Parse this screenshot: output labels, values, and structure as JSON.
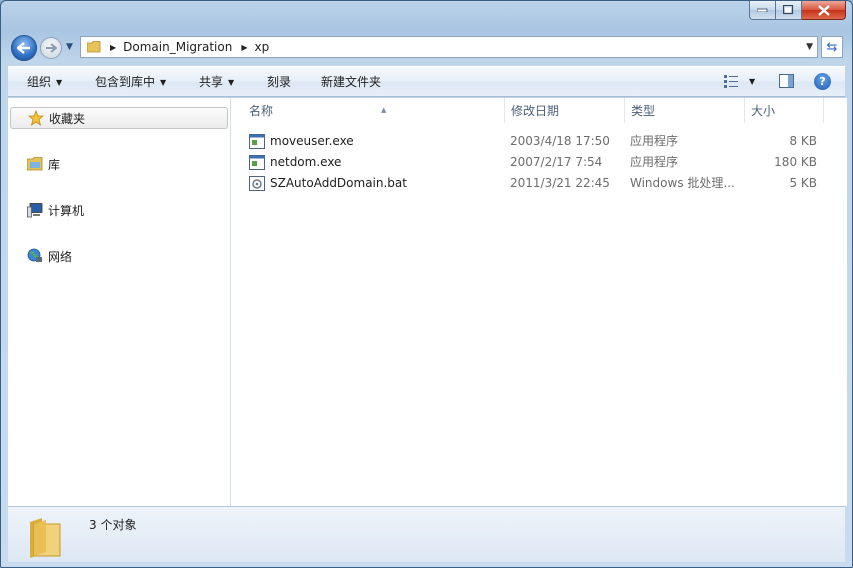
{
  "window": {
    "caption_buttons": {
      "minimize": "minimize",
      "maximize": "maximize",
      "close": "close"
    }
  },
  "address": {
    "breadcrumbs": [
      "Domain_Migration",
      "xp"
    ]
  },
  "toolbar": {
    "organize": "组织",
    "include_in_library": "包含到库中",
    "share": "共享",
    "burn": "刻录",
    "new_folder": "新建文件夹"
  },
  "nav": {
    "items": [
      {
        "label": "收藏夹",
        "icon": "star-icon"
      },
      {
        "label": "库",
        "icon": "library-icon"
      },
      {
        "label": "计算机",
        "icon": "computer-icon"
      },
      {
        "label": "网络",
        "icon": "network-icon"
      }
    ]
  },
  "columns": {
    "name": "名称",
    "date": "修改日期",
    "type": "类型",
    "size": "大小"
  },
  "files": [
    {
      "name": "moveuser.exe",
      "date": "2003/4/18 17:50",
      "type": "应用程序",
      "size": "8 KB",
      "icon": "exe-icon"
    },
    {
      "name": "netdom.exe",
      "date": "2007/2/17 7:54",
      "type": "应用程序",
      "size": "180 KB",
      "icon": "exe-icon"
    },
    {
      "name": "SZAutoAddDomain.bat",
      "date": "2011/3/21 22:45",
      "type": "Windows 批处理...",
      "size": "5 KB",
      "icon": "bat-icon"
    }
  ],
  "status": {
    "count_text": "3 个对象"
  },
  "colors": {
    "accent": "#2e6fc3",
    "close": "#c6311a",
    "header_text": "#4c607a"
  }
}
